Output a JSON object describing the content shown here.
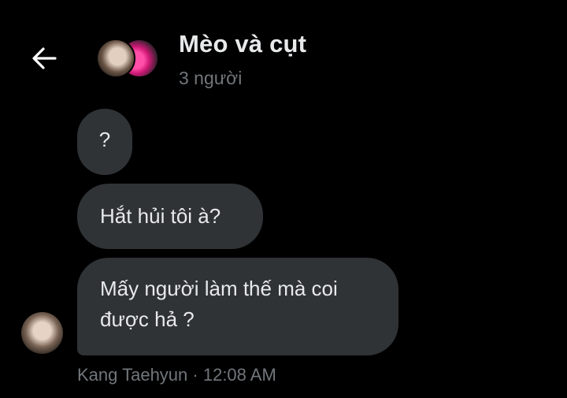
{
  "header": {
    "title": "Mèo và cụt",
    "subtitle": "3 người"
  },
  "messages": [
    {
      "text": "?"
    },
    {
      "text": "Hắt hủi tôi à?"
    },
    {
      "line1": "Mấy người làm thế mà coi",
      "line2": "được hả ?"
    }
  ],
  "message_meta": {
    "sender": "Kang Taehyun",
    "separator": " · ",
    "time": "12:08 AM"
  },
  "colors": {
    "background": "#000000",
    "bubble": "#2f3336",
    "text_primary": "#e7e9ea",
    "text_secondary": "#71767b"
  },
  "icons": {
    "back": "arrow-left-icon"
  }
}
